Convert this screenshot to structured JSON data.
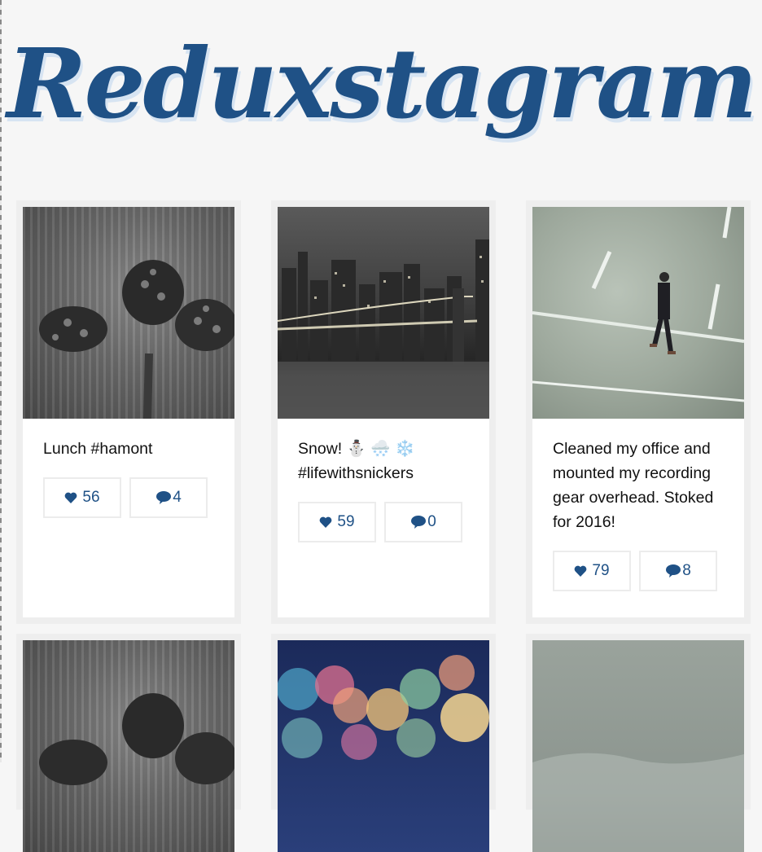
{
  "app": {
    "title": "Reduxstagram"
  },
  "posts": [
    {
      "caption": "Lunch #hamont",
      "likes": "56",
      "comments": "4",
      "photo": "pinecones"
    },
    {
      "caption": "Snow! ⛄ 🌨️ ❄️ #lifewithsnickers",
      "likes": "59",
      "comments": "0",
      "photo": "city-bridge-night"
    },
    {
      "caption": "Cleaned my office and mounted my recording gear overhead. Stoked for 2016!",
      "likes": "79",
      "comments": "8",
      "photo": "man-walking-street"
    }
  ],
  "photos_row2": [
    "pinecones",
    "bokeh-lights",
    "foggy-landscape"
  ],
  "icons": {
    "like": "heart-icon",
    "comment": "speech-bubble-icon"
  },
  "colors": {
    "accent": "#1f5186",
    "background": "#f6f6f6",
    "card_border": "#eeeeee"
  }
}
